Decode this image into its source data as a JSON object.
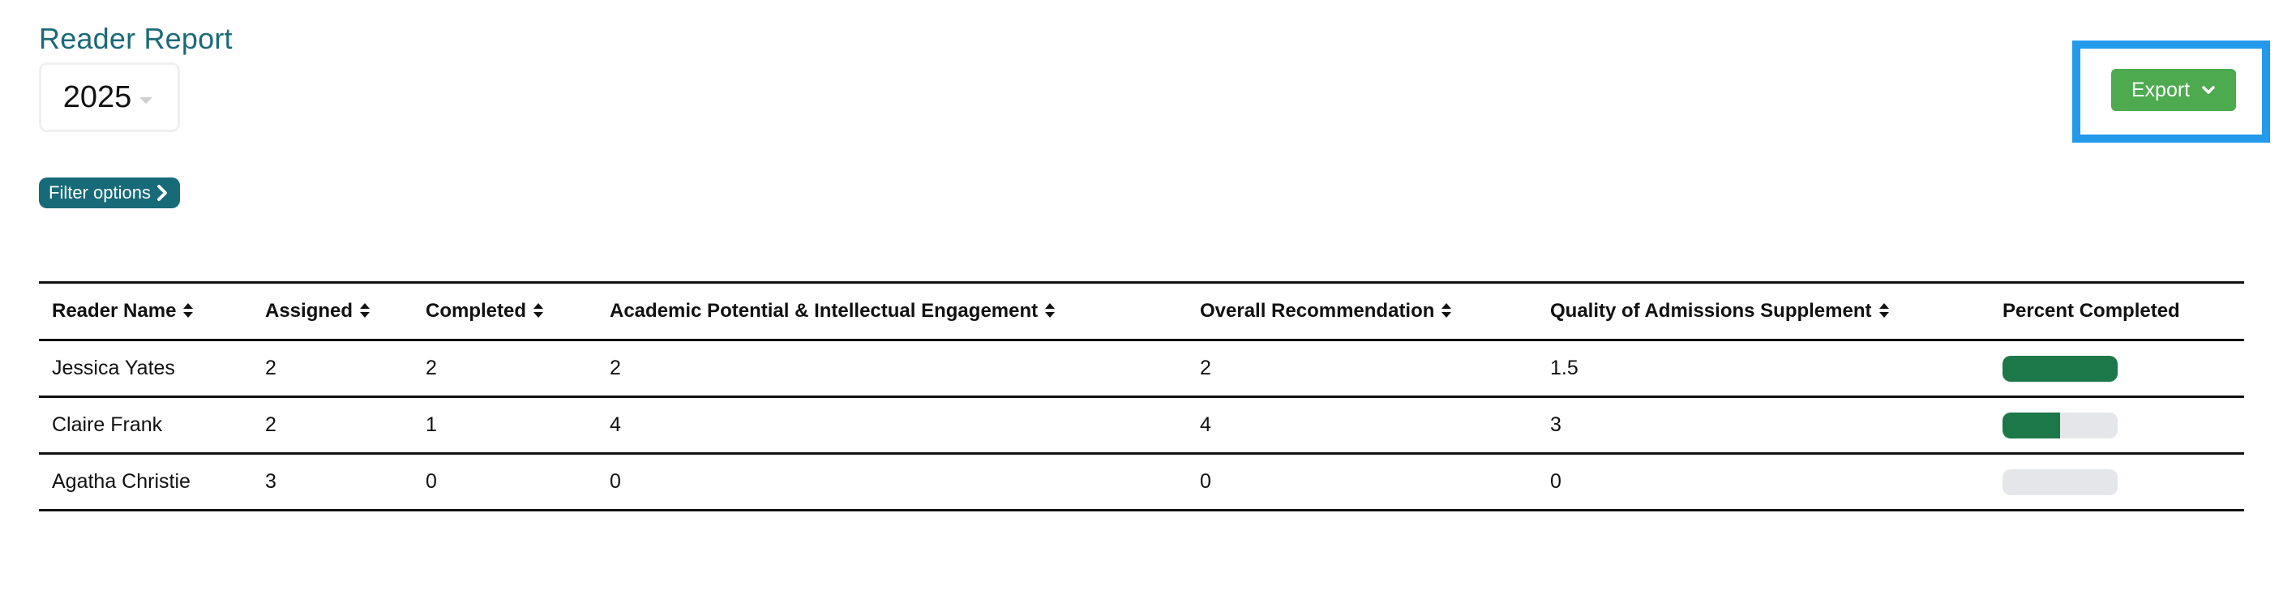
{
  "header": {
    "title": "Reader Report",
    "year_select": {
      "value": "2025"
    },
    "filter_button_label": "Filter options",
    "export_button_label": "Export"
  },
  "colors": {
    "title": "#1b6a7a",
    "filter_button": "#176a78",
    "export_button": "#4daa4e",
    "highlight_box": "#239aeb",
    "progress_fill": "#1c7848",
    "progress_track": "#e5e6e9"
  },
  "table": {
    "columns": [
      {
        "label": "Reader Name",
        "sortable": true
      },
      {
        "label": "Assigned",
        "sortable": true
      },
      {
        "label": "Completed",
        "sortable": true
      },
      {
        "label": "Academic Potential & Intellectual Engagement",
        "sortable": true
      },
      {
        "label": "Overall Recommendation",
        "sortable": true
      },
      {
        "label": "Quality of Admissions Supplement",
        "sortable": true
      },
      {
        "label": "Percent Completed",
        "sortable": false
      }
    ],
    "rows": [
      {
        "reader_name": "Jessica Yates",
        "assigned": "2",
        "completed": "2",
        "academic": "2",
        "overall": "2",
        "quality": "1.5",
        "percent_completed": 100
      },
      {
        "reader_name": "Claire Frank",
        "assigned": "2",
        "completed": "1",
        "academic": "4",
        "overall": "4",
        "quality": "3",
        "percent_completed": 50
      },
      {
        "reader_name": "Agatha Christie",
        "assigned": "3",
        "completed": "0",
        "academic": "0",
        "overall": "0",
        "quality": "0",
        "percent_completed": 0
      }
    ]
  }
}
